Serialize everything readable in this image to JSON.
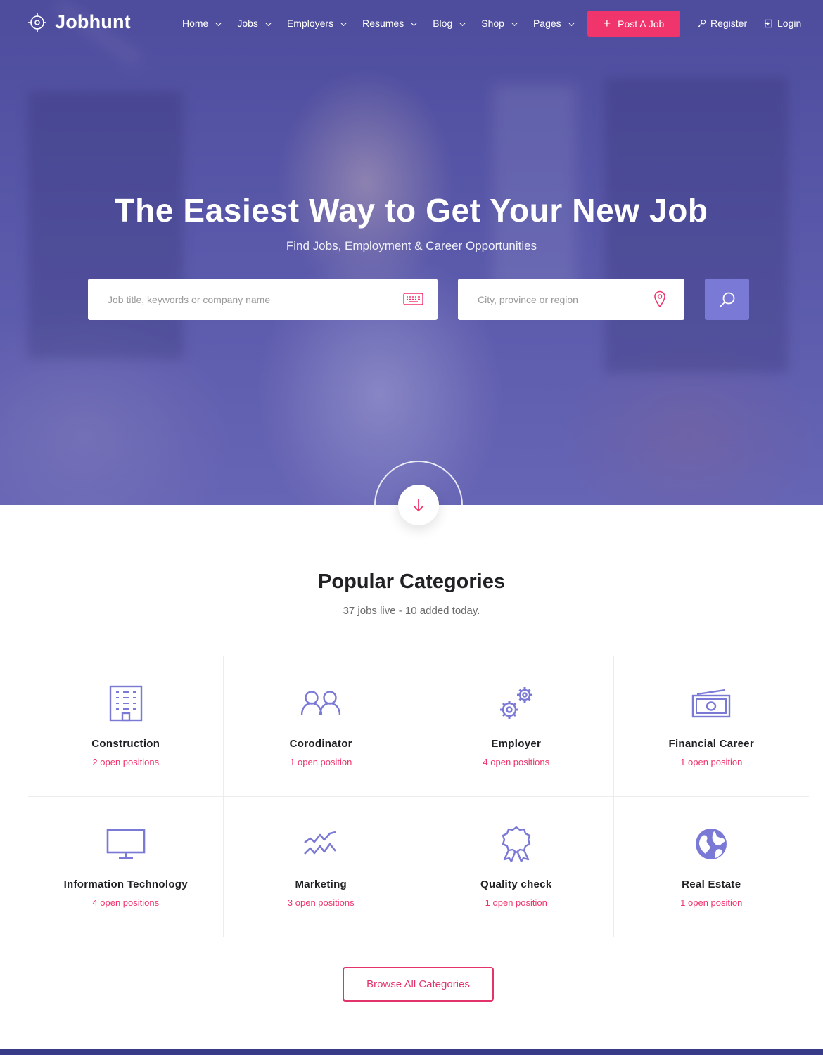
{
  "header": {
    "logo_text": "Jobhunt",
    "nav": [
      {
        "label": "Home"
      },
      {
        "label": "Jobs"
      },
      {
        "label": "Employers"
      },
      {
        "label": "Resumes"
      },
      {
        "label": "Blog"
      },
      {
        "label": "Shop"
      },
      {
        "label": "Pages"
      }
    ],
    "post_job_label": "Post A Job",
    "register_label": "Register",
    "login_label": "Login"
  },
  "hero": {
    "title": "The Easiest Way to Get Your New Job",
    "subtitle": "Find Jobs, Employment & Career Opportunities",
    "keyword_placeholder": "Job title, keywords or company name",
    "location_placeholder": "City, province or region"
  },
  "categories": {
    "title": "Popular Categories",
    "subtitle": "37 jobs live - 10 added today.",
    "items": [
      {
        "name": "Construction",
        "count": "2 open positions",
        "icon": "building-icon"
      },
      {
        "name": "Corodinator",
        "count": "1 open position",
        "icon": "users-icon"
      },
      {
        "name": "Employer",
        "count": "4 open positions",
        "icon": "gears-icon"
      },
      {
        "name": "Financial Career",
        "count": "1 open position",
        "icon": "money-icon"
      },
      {
        "name": "Information Technology",
        "count": "4 open positions",
        "icon": "monitor-icon"
      },
      {
        "name": "Marketing",
        "count": "3 open positions",
        "icon": "trend-icon"
      },
      {
        "name": "Quality check",
        "count": "1 open position",
        "icon": "award-icon"
      },
      {
        "name": "Real Estate",
        "count": "1 open position",
        "icon": "globe-icon"
      }
    ],
    "browse_label": "Browse All Categories"
  },
  "colors": {
    "accent_pink": "#f0346c",
    "icon_purple": "#7b79d6",
    "footer_navy": "#383c87"
  }
}
